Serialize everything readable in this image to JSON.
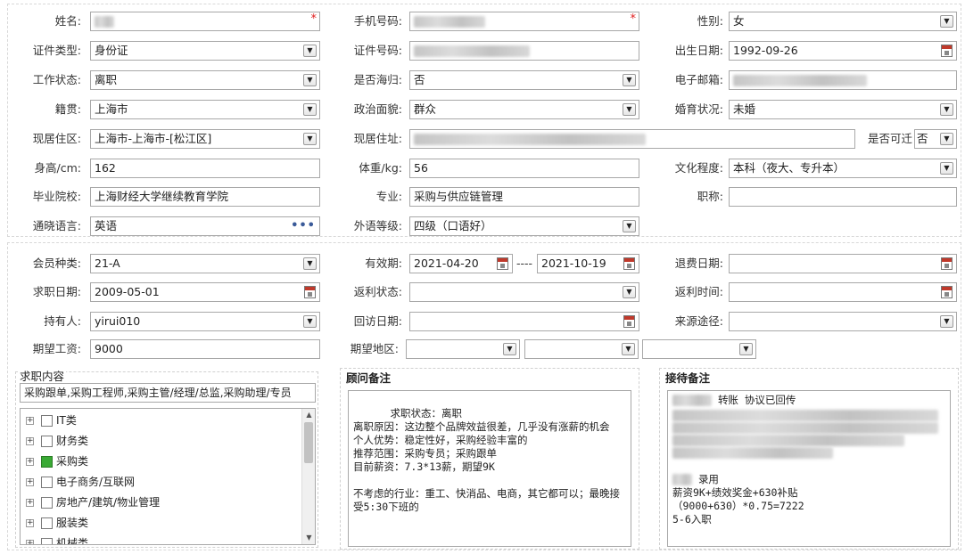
{
  "basic": {
    "name_label": "姓名:",
    "phone_label": "手机号码:",
    "gender_label": "性别:",
    "gender_value": "女",
    "id_type_label": "证件类型:",
    "id_type_value": "身份证",
    "id_no_label": "证件号码:",
    "birth_label": "出生日期:",
    "birth_value": "1992-09-26",
    "work_status_label": "工作状态:",
    "work_status_value": "离职",
    "returnee_label": "是否海归:",
    "returnee_value": "否",
    "email_label": "电子邮箱:",
    "origin_label": "籍贯:",
    "origin_value": "上海市",
    "political_label": "政治面貌:",
    "political_value": "群众",
    "marital_label": "婚育状况:",
    "marital_value": "未婚",
    "residence_label": "现居住区:",
    "residence_value": "上海市-上海市-[松江区]",
    "address_label": "现居住址:",
    "relocate_label": "是否可迁",
    "relocate_value": "否",
    "height_label": "身高/cm:",
    "height_value": "162",
    "weight_label": "体重/kg:",
    "weight_value": "56",
    "education_label": "文化程度:",
    "education_value": "本科（夜大、专升本）",
    "school_label": "毕业院校:",
    "school_value": "上海财经大学继续教育学院",
    "major_label": "专业:",
    "major_value": "采购与供应链管理",
    "title_label": "职称:",
    "title_value": "",
    "language_label": "通晓语言:",
    "language_value": "英语",
    "lang_level_label": "外语等级:",
    "lang_level_value": "四级（口语好）"
  },
  "membership": {
    "member_type_label": "会员种类:",
    "member_type_value": "21-A",
    "validity_label": "有效期:",
    "validity_from": "2021-04-20",
    "validity_sep": "----",
    "validity_to": "2021-10-19",
    "refund_date_label": "退费日期:",
    "job_date_label": "求职日期:",
    "job_date_value": "2009-05-01",
    "rebate_status_label": "返利状态:",
    "rebate_time_label": "返利时间:",
    "holder_label": "持有人:",
    "holder_value": "yirui010",
    "visit_date_label": "回访日期:",
    "source_label": "来源途径:",
    "salary_label": "期望工资:",
    "salary_value": "9000",
    "region_label": "期望地区:"
  },
  "job_content": {
    "title": "求职内容",
    "selected_text": "采购跟单,采购工程师,采购主管/经理/总监,采购助理/专员",
    "tree": [
      {
        "label": "IT类",
        "checked": false
      },
      {
        "label": "财务类",
        "checked": false
      },
      {
        "label": "采购类",
        "checked": true
      },
      {
        "label": "电子商务/互联网",
        "checked": false
      },
      {
        "label": "房地产/建筑/物业管理",
        "checked": false
      },
      {
        "label": "服装类",
        "checked": false
      },
      {
        "label": "机械类",
        "checked": false
      }
    ]
  },
  "consultant_note": {
    "title": "顾问备注",
    "text": "求职状态：离职\n离职原因：这边整个品牌效益很差，几乎没有涨薪的机会\n个人优势：稳定性好，采购经验丰富的\n推荐范围：采购专员；采购跟单\n目前薪资：7.3*13薪，期望9K\n\n不考虑的行业：重工、快消品、电商，其它都可以；最晚接受5:30下班的"
  },
  "reception_note": {
    "title": "接待备注",
    "line1": "转账 协议已回传",
    "line_hired": "录用",
    "line_salary": "薪资9K+绩效奖金+630补贴",
    "line_calc": "（9000+630）*0.75=7222",
    "line_start": "5-6入职"
  }
}
